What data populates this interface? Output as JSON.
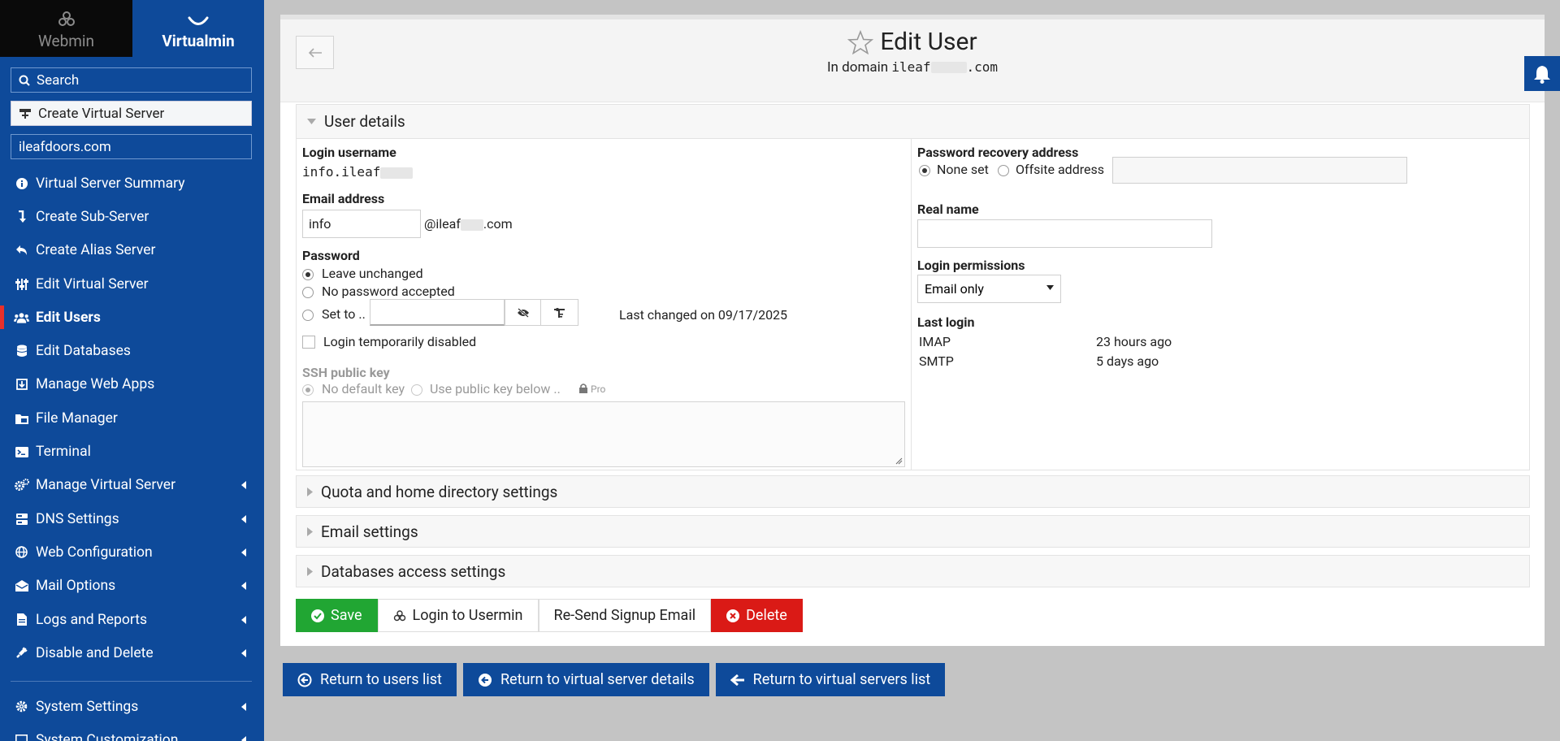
{
  "sidebar": {
    "switcher": {
      "webmin": "Webmin",
      "virtualmin": "Virtualmin"
    },
    "search_label": "Search",
    "create_label": "Create Virtual Server",
    "domain": "ileafdoors.com",
    "items": [
      {
        "label": "Virtual Server Summary",
        "icon": "info-icon"
      },
      {
        "label": "Create Sub-Server",
        "icon": "sub-server-icon"
      },
      {
        "label": "Create Alias Server",
        "icon": "reply-icon"
      },
      {
        "label": "Edit Virtual Server",
        "icon": "sliders-icon"
      },
      {
        "label": "Edit Users",
        "icon": "users-icon",
        "active": true
      },
      {
        "label": "Edit Databases",
        "icon": "database-icon"
      },
      {
        "label": "Manage Web Apps",
        "icon": "download-box-icon"
      },
      {
        "label": "File Manager",
        "icon": "folder-icon"
      },
      {
        "label": "Terminal",
        "icon": "terminal-icon"
      },
      {
        "label": "Manage Virtual Server",
        "icon": "cogs-icon",
        "submenu": true
      },
      {
        "label": "DNS Settings",
        "icon": "server-icon",
        "submenu": true
      },
      {
        "label": "Web Configuration",
        "icon": "globe-icon",
        "submenu": true
      },
      {
        "label": "Mail Options",
        "icon": "envelope-open-icon",
        "submenu": true
      },
      {
        "label": "Logs and Reports",
        "icon": "file-icon",
        "submenu": true
      },
      {
        "label": "Disable and Delete",
        "icon": "plug-icon",
        "submenu": true
      }
    ],
    "system_settings": "System Settings",
    "system_customization": "System Customization"
  },
  "header": {
    "title": "Edit User",
    "subtitle_prefix": "In domain",
    "subtitle_domain_start": "ileaf",
    "subtitle_domain_end": ".com"
  },
  "user_details": {
    "section_title": "User details",
    "login_username_label": "Login username",
    "login_username_value": "info.ileaf",
    "email_label": "Email address",
    "email_value": "info",
    "email_domain_start": "@ileaf",
    "email_domain_end": ".com",
    "password_label": "Password",
    "pw_leave": "Leave unchanged",
    "pw_none": "No password accepted",
    "pw_set": "Set to ..",
    "pw_last_changed": "Last changed on 09/17/2025",
    "login_disabled": "Login temporarily disabled",
    "ssh_label": "SSH public key",
    "ssh_no_default": "No default key",
    "ssh_use_below": "Use public key below ..",
    "ssh_pro": "Pro",
    "recovery_label": "Password recovery address",
    "recovery_none": "None set",
    "recovery_offsite": "Offsite address",
    "real_name_label": "Real name",
    "real_name_value": "",
    "permissions_label": "Login permissions",
    "permissions_value": "Email only",
    "last_login_label": "Last login",
    "last_login": [
      {
        "protocol": "IMAP",
        "when": "23 hours ago"
      },
      {
        "protocol": "SMTP",
        "when": "5 days ago"
      }
    ]
  },
  "sections": {
    "quota": "Quota and home directory settings",
    "email": "Email settings",
    "databases": "Databases access settings"
  },
  "actions": {
    "save": "Save",
    "login_usermin": "Login to Usermin",
    "resend": "Re-Send Signup Email",
    "delete": "Delete"
  },
  "bottom": {
    "return_users": "Return to users list",
    "return_server_details": "Return to virtual server details",
    "return_servers_list": "Return to virtual servers list"
  },
  "colors": {
    "sidebar": "#0e4a9a",
    "save": "#21a633",
    "delete": "#da1a16",
    "active_marker": "#e8302a"
  }
}
